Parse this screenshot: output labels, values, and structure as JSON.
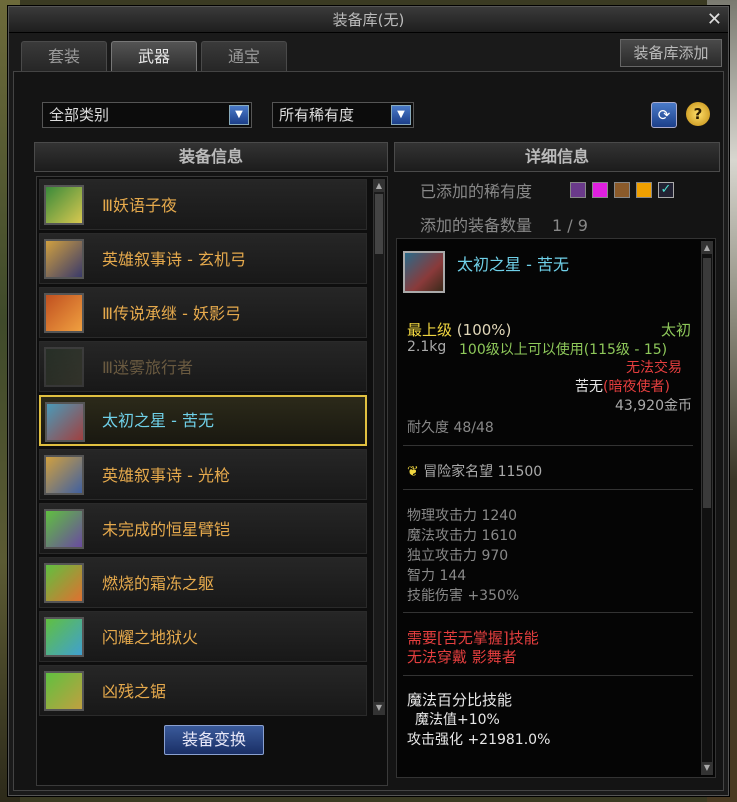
{
  "window": {
    "title": "装备库(无)",
    "close": "✕",
    "add_button": "装备库添加"
  },
  "tabs": [
    {
      "label": "套装",
      "active": false
    },
    {
      "label": "武器",
      "active": true
    },
    {
      "label": "通宝",
      "active": false
    }
  ],
  "filters": {
    "category": "全部类别",
    "rarity": "所有稀有度",
    "refresh_icon": "refresh-icon",
    "help_label": "?"
  },
  "left": {
    "header": "装备信息",
    "items": [
      {
        "name": "Ⅲ妖语子夜",
        "selected": false,
        "faded": false,
        "icon_colors": [
          "#3a8a3a",
          "#d8c850"
        ]
      },
      {
        "name": "英雄叙事诗 - 玄机弓",
        "selected": false,
        "faded": false,
        "icon_colors": [
          "#d0a040",
          "#3a3a6a"
        ]
      },
      {
        "name": "Ⅲ传说承继 - 妖影弓",
        "selected": false,
        "faded": false,
        "icon_colors": [
          "#c05020",
          "#f0a040"
        ]
      },
      {
        "name": "Ⅲ迷雾旅行者",
        "selected": false,
        "faded": true,
        "icon_colors": [
          "#2a3a2a",
          "#4a4a3a"
        ]
      },
      {
        "name": "太初之星 - 苦无",
        "selected": true,
        "faded": false,
        "icon_colors": [
          "#4a9ab8",
          "#a04040"
        ]
      },
      {
        "name": "英雄叙事诗 - 光枪",
        "selected": false,
        "faded": false,
        "icon_colors": [
          "#d0a040",
          "#4060a0"
        ]
      },
      {
        "name": "未完成的恒星臂铠",
        "selected": false,
        "faded": false,
        "icon_colors": [
          "#60c040",
          "#6a4aa0"
        ]
      },
      {
        "name": "燃烧的霜冻之躯",
        "selected": false,
        "faded": false,
        "icon_colors": [
          "#60c040",
          "#e07030"
        ]
      },
      {
        "name": "闪耀之地狱火",
        "selected": false,
        "faded": false,
        "icon_colors": [
          "#60c040",
          "#40a0d0"
        ]
      },
      {
        "name": "凶残之锯",
        "selected": false,
        "faded": false,
        "icon_colors": [
          "#60c040",
          "#c0a040"
        ]
      }
    ],
    "change_button": "装备变换"
  },
  "right": {
    "header": "详细信息",
    "rarity_label": "已添加的稀有度",
    "rarity_colors": [
      "#6a3a8a",
      "#e020e0",
      "#8a5a2a",
      "#f0a000"
    ],
    "rarity_check": "✓",
    "count_label": "添加的装备数量",
    "count_value": "1 / 9"
  },
  "detail": {
    "name": "太初之星 - 苦无",
    "grade": "最上级",
    "grade_pct": "(100%)",
    "rarity": "太初",
    "weight": "2.1kg",
    "level_req": "100级以上可以使用(115级 - 15)",
    "trade": "无法交易",
    "class_name": "苦无",
    "class_req": "(暗夜使者)",
    "price": "43,920金币",
    "durability": "耐久度 48/48",
    "fame_label": "冒险家名望",
    "fame_value": "11500",
    "stats": [
      {
        "label": "物理攻击力",
        "value": "1240"
      },
      {
        "label": "魔法攻击力",
        "value": "1610"
      },
      {
        "label": "独立攻击力",
        "value": "970"
      },
      {
        "label": "智力",
        "value": "144"
      },
      {
        "label": "技能伤害",
        "value": "+350%"
      }
    ],
    "req1": "需要[苦无掌握]技能",
    "req2": "无法穿戴 影舞者",
    "skill_title": "魔法百分比技能",
    "skill_mp": "魔法值+10%",
    "skill_enh": "攻击强化 +21981.0%"
  }
}
